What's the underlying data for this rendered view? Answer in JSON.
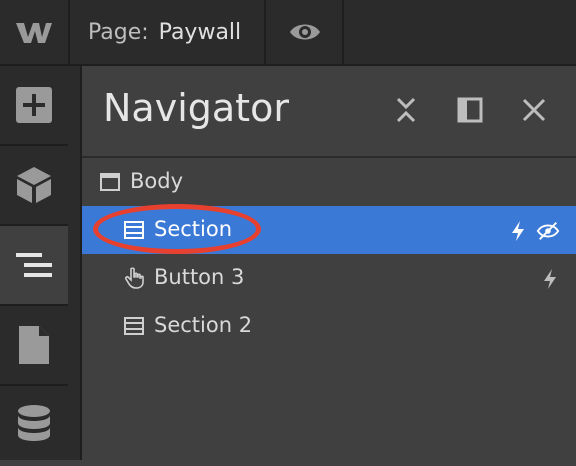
{
  "topbar": {
    "page_label": "Page:",
    "page_name": "Paywall"
  },
  "icons": {
    "logo": "webflow-logo",
    "preview": "eye-icon",
    "rail": [
      "add-icon",
      "cube-icon",
      "navigator-icon",
      "pages-icon",
      "database-icon"
    ],
    "header": [
      "collapse-icon",
      "dock-panel-icon",
      "close-icon"
    ]
  },
  "navigator": {
    "title": "Navigator",
    "rows": [
      {
        "label": "Body",
        "icon": "body-icon",
        "selected": false
      },
      {
        "label": "Section",
        "icon": "section-icon",
        "selected": true,
        "right_icons": [
          "lightning-icon",
          "eye-off-icon"
        ]
      },
      {
        "label": "Button 3",
        "icon": "hand-pointer-icon",
        "selected": false,
        "right_icons": [
          "lightning-icon"
        ]
      },
      {
        "label": "Section 2",
        "icon": "section-icon",
        "selected": false
      }
    ]
  },
  "colors": {
    "selected_row": "#3b79d6",
    "annotation_ring": "#e8402e",
    "panel_bg": "#404040",
    "chrome_bg": "#2b2b2b"
  }
}
